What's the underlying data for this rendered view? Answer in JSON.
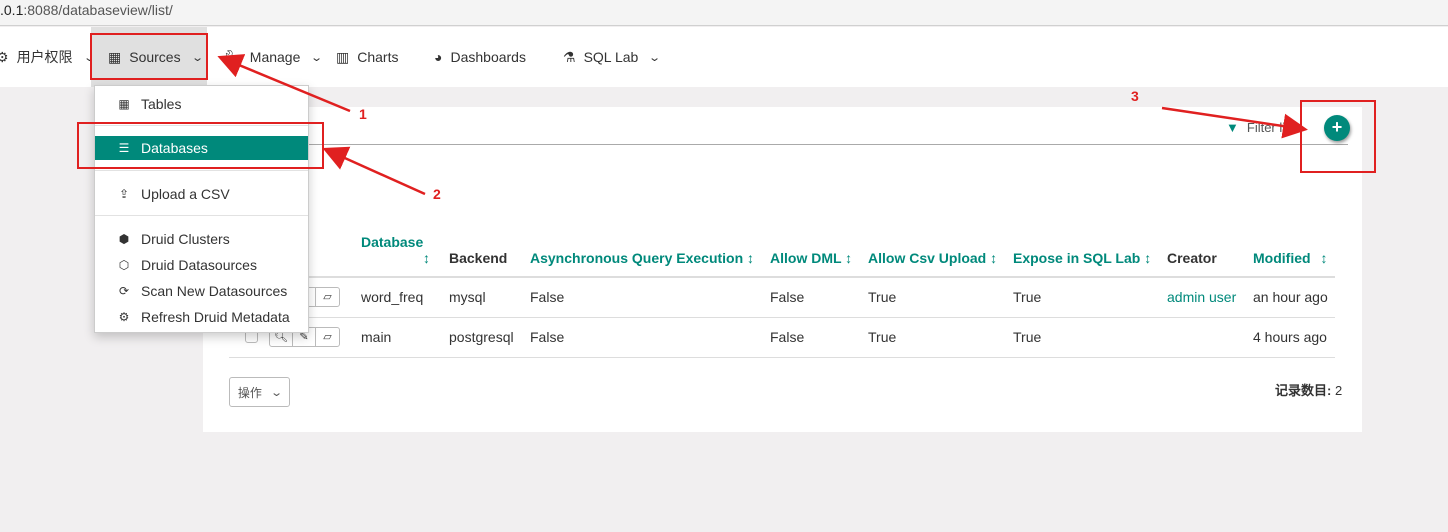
{
  "browser": {
    "url_prefix": ".0.1",
    "url_rest": ":8088/databaseview/list/"
  },
  "nav": {
    "items": [
      {
        "label": "用户权限",
        "icon": "users-icon",
        "dropdown": true
      },
      {
        "label": "Sources",
        "icon": "table-icon",
        "dropdown": true,
        "active": true
      },
      {
        "label": "Manage",
        "icon": "wrench-icon",
        "dropdown": true
      },
      {
        "label": "Charts",
        "icon": "bar-chart-icon",
        "dropdown": false
      },
      {
        "label": "Dashboards",
        "icon": "dashboard-icon",
        "dropdown": false
      },
      {
        "label": "SQL Lab",
        "icon": "flask-icon",
        "dropdown": true
      }
    ]
  },
  "sources_menu": {
    "items": [
      {
        "label": "Tables",
        "icon": "table-icon"
      },
      {
        "label": "Databases",
        "icon": "database-icon",
        "selected": true
      },
      {
        "label": "Upload a CSV",
        "icon": "upload-icon"
      },
      {
        "label": "Druid Clusters",
        "icon": "cubes-icon"
      },
      {
        "label": "Druid Datasources",
        "icon": "cube-icon"
      },
      {
        "label": "Scan New Datasources",
        "icon": "refresh-icon"
      },
      {
        "label": "Refresh Druid Metadata",
        "icon": "gear-icon"
      }
    ]
  },
  "toolbar": {
    "filter_label": "Filter list",
    "add_label": "+"
  },
  "table": {
    "headers": [
      "Database",
      "Backend",
      "Asynchronous Query Execution",
      "Allow DML",
      "Allow Csv Upload",
      "Expose in SQL Lab",
      "Creator",
      "Modified"
    ],
    "rows": [
      [
        "word_freq",
        "mysql",
        "False",
        "False",
        "True",
        "True",
        "admin user",
        "an hour ago"
      ],
      [
        "main",
        "postgresql",
        "False",
        "False",
        "True",
        "True",
        "",
        "4 hours ago"
      ]
    ]
  },
  "footer": {
    "actions_label": "操作",
    "count_label": "记录数目:",
    "count": "2"
  },
  "annotations": {
    "labels": [
      "1",
      "2",
      "3"
    ],
    "color": "#e02020"
  },
  "colors": {
    "accent": "#00897b"
  }
}
